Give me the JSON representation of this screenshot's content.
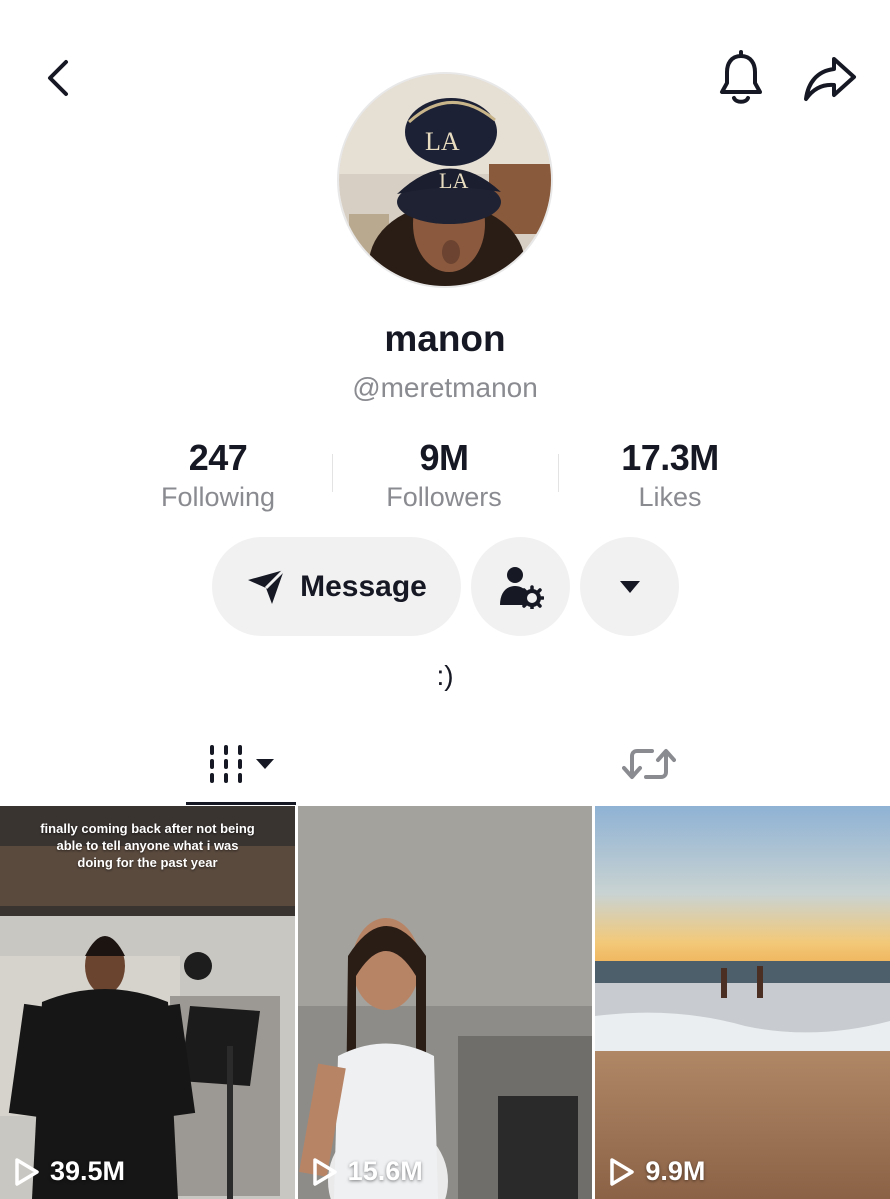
{
  "profile": {
    "name": "manon",
    "handle": "@meretmanon",
    "bio": ":)"
  },
  "stats": [
    {
      "value": "247",
      "label": "Following"
    },
    {
      "value": "9M",
      "label": "Followers"
    },
    {
      "value": "17.3M",
      "label": "Likes"
    }
  ],
  "actions": {
    "message_label": "Message"
  },
  "icons": {
    "back": "back-icon",
    "bell": "bell-icon",
    "share": "share-icon",
    "message": "send-icon",
    "person": "person-settings-icon",
    "dropdown": "caret-down-icon",
    "videos_tab": "grid-icon",
    "reposts_tab": "repost-icon",
    "play": "play-icon"
  },
  "videos": [
    {
      "views": "39.5M",
      "caption": "finally coming back after not being able to tell anyone what i was doing for the past year"
    },
    {
      "views": "15.6M",
      "caption": ""
    },
    {
      "views": "9.9M",
      "caption": ""
    }
  ],
  "colors": {
    "text": "#161823",
    "muted": "#8a8b91",
    "button_bg": "#f1f1f2"
  }
}
